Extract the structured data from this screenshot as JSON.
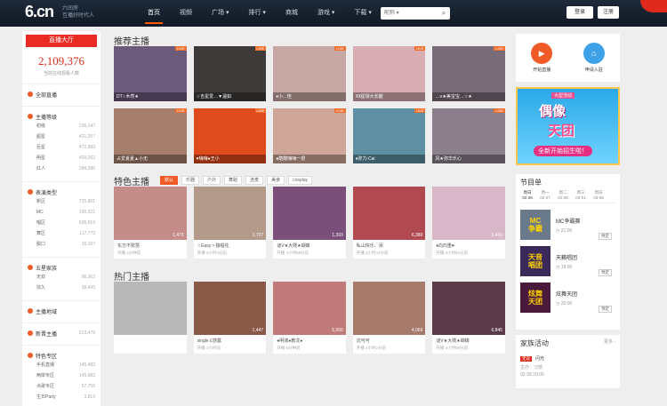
{
  "header": {
    "logo_text": "6.cn",
    "logo_sub1": "六间房",
    "logo_sub2": "互播好时代人",
    "nav": [
      "首页",
      "视频",
      "广场 ▾",
      "排行 ▾",
      "商城",
      "游戏 ▾",
      "下载 ▾"
    ],
    "search_placeholder": "昵称 ▾",
    "login_label": "登录",
    "register_label": "注册"
  },
  "left": {
    "hall_label": "直播大厅",
    "online_count": "2,109,376",
    "online_caption": "当前在线观看人数",
    "sections": [
      {
        "title": "全部直播",
        "items": []
      },
      {
        "title": "主播等级",
        "items": [
          {
            "label": "初级",
            "count": "236,147"
          },
          {
            "label": "超星",
            "count": "421,257"
          },
          {
            "label": "巨星",
            "count": "472,983"
          },
          {
            "label": "明星",
            "count": "409,262"
          },
          {
            "label": "红人",
            "count": "284,286"
          }
        ]
      },
      {
        "title": "表演类型",
        "items": [
          {
            "label": "新区",
            "count": "725,881"
          },
          {
            "label": "MC",
            "count": "190,321"
          },
          {
            "label": "唱区",
            "count": "605,019"
          },
          {
            "label": "舞区",
            "count": "117,773"
          },
          {
            "label": "脱口",
            "count": "16,167"
          }
        ]
      },
      {
        "title": "五星家族",
        "items": [
          {
            "label": "无双",
            "count": "96,363"
          },
          {
            "label": "炫久",
            "count": "38,449"
          }
        ]
      },
      {
        "title": "主播地域",
        "items": []
      },
      {
        "title": "新晋主播",
        "count": "223,476",
        "items": []
      },
      {
        "title": "特色专区",
        "items": [
          {
            "label": "手机直播",
            "count": "145,483"
          },
          {
            "label": "两岸专区",
            "count": "145,682"
          },
          {
            "label": "点歌专区",
            "count": "57,756"
          },
          {
            "label": "生日Party",
            "count": "3,810"
          }
        ]
      }
    ]
  },
  "recommend": {
    "title": "推荐主播",
    "row1": [
      {
        "name": "DT♀木然★",
        "bg": "#6b5a7a"
      },
      {
        "name": "☆吉星爱…▼温如",
        "bg": "#3e3a3a"
      },
      {
        "name": "♦小…佳",
        "bg": "#c7a8a4"
      },
      {
        "name": "ⅩⅡ星球大长腿",
        "bg": "#d8aeb4"
      },
      {
        "name": "…ⅴ★美宝宝…☆★",
        "bg": "#7a6b78"
      }
    ],
    "row2": [
      {
        "name": "占爱夏夏▲小无",
        "bg": "#a57f6c"
      },
      {
        "name": "♥嗨嗨●王小",
        "bg": "#e04b1e"
      },
      {
        "name": "●酷酷嗨嗨一把",
        "bg": "#cfa79a"
      },
      {
        "name": "♦弥力-Cai",
        "bg": "#5f8fa2"
      },
      {
        "name": "风★弥华乐心",
        "bg": "#8a7f8a"
      }
    ]
  },
  "special": {
    "title": "特色主播",
    "tags": [
      "默认",
      "乐器",
      "户外",
      "舞蹈",
      "连麦",
      "美食",
      "cosplay"
    ],
    "cards": [
      {
        "name": "东方不败慧",
        "time": "开播 4分钟前",
        "views": "1,473",
        "bg": "#c48d8a"
      },
      {
        "name": "☆Easy〃独唱花",
        "time": "开播 3小时4分前",
        "views": "1,727",
        "bg": "#b49a8a"
      },
      {
        "name": "谜Ⅴ★大贱★蝴蝶",
        "time": "开播 4小时58分前",
        "views": "1,393",
        "bg": "#7a4f7a"
      },
      {
        "name": "私山快乐、添",
        "time": "开播 3小时41分前",
        "views": "6,380",
        "bg": "#b04a50"
      },
      {
        "name": "♦向向重♥-",
        "time": "开播 4小时51分前",
        "views": "1,416",
        "bg": "#d8b8c8"
      }
    ]
  },
  "hot": {
    "title": "热门主播",
    "cards": [
      {
        "name": "",
        "time": "",
        "views": "",
        "bg": "#b8b8b8"
      },
      {
        "name": "single £感露",
        "time": "开播 1小时前",
        "views": "1,447",
        "bg": "#8a5a48"
      },
      {
        "name": "●明城●教龙●",
        "time": "开播 5分钟前",
        "views": "5,360",
        "bg": "#c07a7a"
      },
      {
        "name": "沈可可",
        "time": "开播 4小时2分前",
        "views": "4,066",
        "bg": "#a67a6a"
      },
      {
        "name": "谜Ⅴ★大贱★蝴蝶",
        "time": "开播 4小时58分前",
        "views": "6,845",
        "bg": "#5a3a48"
      }
    ]
  },
  "right": {
    "quick": [
      {
        "label": "开始直播",
        "color": "#f05a28"
      },
      {
        "label": "申请入驻",
        "color": "#3fa2e8"
      }
    ],
    "ad": {
      "t1": "大型活动",
      "t2": "偶像",
      "t3": "天团",
      "t4": "全新开始招生啦！"
    },
    "schedule": {
      "title": "节目单",
      "days": [
        "周日\n02-26",
        "周一\n02-27",
        "周二\n02-28",
        "周三\n03-01",
        "周日\n03-05"
      ],
      "programs": [
        {
          "name": "MC争霸赛",
          "time": "21:00",
          "btn": "预定",
          "img": "MC\n争霸",
          "bg": "#6a7a8a"
        },
        {
          "name": "天籁唱团",
          "time": "19:00",
          "btn": "预定",
          "img": "天音\n唱团",
          "bg": "#3a2a5a"
        },
        {
          "name": "炫舞天团",
          "time": "20:00",
          "btn": "预定",
          "img": "炫舞\n天团",
          "bg": "#4a1a3a"
        }
      ]
    },
    "family": {
      "title": "家族活动",
      "more": "更多 ›",
      "badge": "无双",
      "name": "闪光",
      "owner": "主办：习惯",
      "time": "02-28 20:00"
    }
  }
}
